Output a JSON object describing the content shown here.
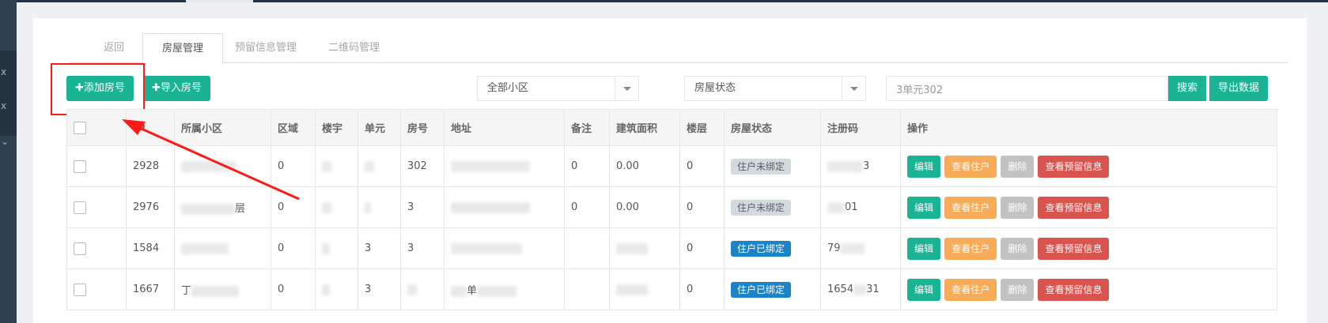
{
  "sidebar": {
    "marks": [
      "x",
      "x",
      "⌄"
    ]
  },
  "tabs": [
    {
      "label": "返回"
    },
    {
      "label": "房屋管理"
    },
    {
      "label": "预留信息管理"
    },
    {
      "label": "二维码管理"
    }
  ],
  "toolbar": {
    "add_label": "✚添加房号",
    "import_label": "✚导入房号",
    "community_select": "全部小区",
    "status_select": "房屋状态",
    "search_value": "3单元302",
    "search_label": "搜索",
    "export_label": "导出数据"
  },
  "table": {
    "headers": [
      "",
      "ID",
      "所属小区",
      "区域",
      "楼宇",
      "单元",
      "房号",
      "地址",
      "备注",
      "建筑面积",
      "楼层",
      "房屋状态",
      "注册码",
      "操作"
    ],
    "rows": [
      {
        "id": "2928",
        "community": "",
        "area": "0",
        "building": "",
        "unit": "",
        "room": "302",
        "address": "",
        "note": "0",
        "floor_area": "0.00",
        "floor": "0",
        "status": "住户未绑定",
        "status_type": "unbound",
        "code": "",
        "code_tail": "3"
      },
      {
        "id": "2976",
        "community": "",
        "community_tail": "层",
        "area": "0",
        "building": "",
        "unit": "",
        "room": "3",
        "address": "",
        "note": "0",
        "floor_area": "0.00",
        "floor": "0",
        "status": "住户未绑定",
        "status_type": "unbound",
        "code": "01",
        "code_tail": ""
      },
      {
        "id": "1584",
        "community": "",
        "area": "0",
        "building": "",
        "unit": "3",
        "room": "3",
        "address": "",
        "note": "",
        "floor_area": "",
        "floor": "0",
        "status": "住户已绑定",
        "status_type": "bound",
        "code": "79",
        "code_tail": ""
      },
      {
        "id": "1667",
        "community": "丁",
        "area": "0",
        "building": "",
        "unit": "3",
        "room": "",
        "address": "单",
        "note": "",
        "floor_area": "",
        "floor": "0",
        "status": "住户已绑定",
        "status_type": "bound",
        "code": "1654",
        "code_tail": "31"
      }
    ],
    "actions": {
      "edit": "编辑",
      "view_residents": "查看住户",
      "delete": "删除",
      "view_reserved": "查看预留信息"
    }
  },
  "colors": {
    "accent": "#1ab394",
    "bound": "#1c84c6",
    "highlight": "#ff1a1a"
  }
}
